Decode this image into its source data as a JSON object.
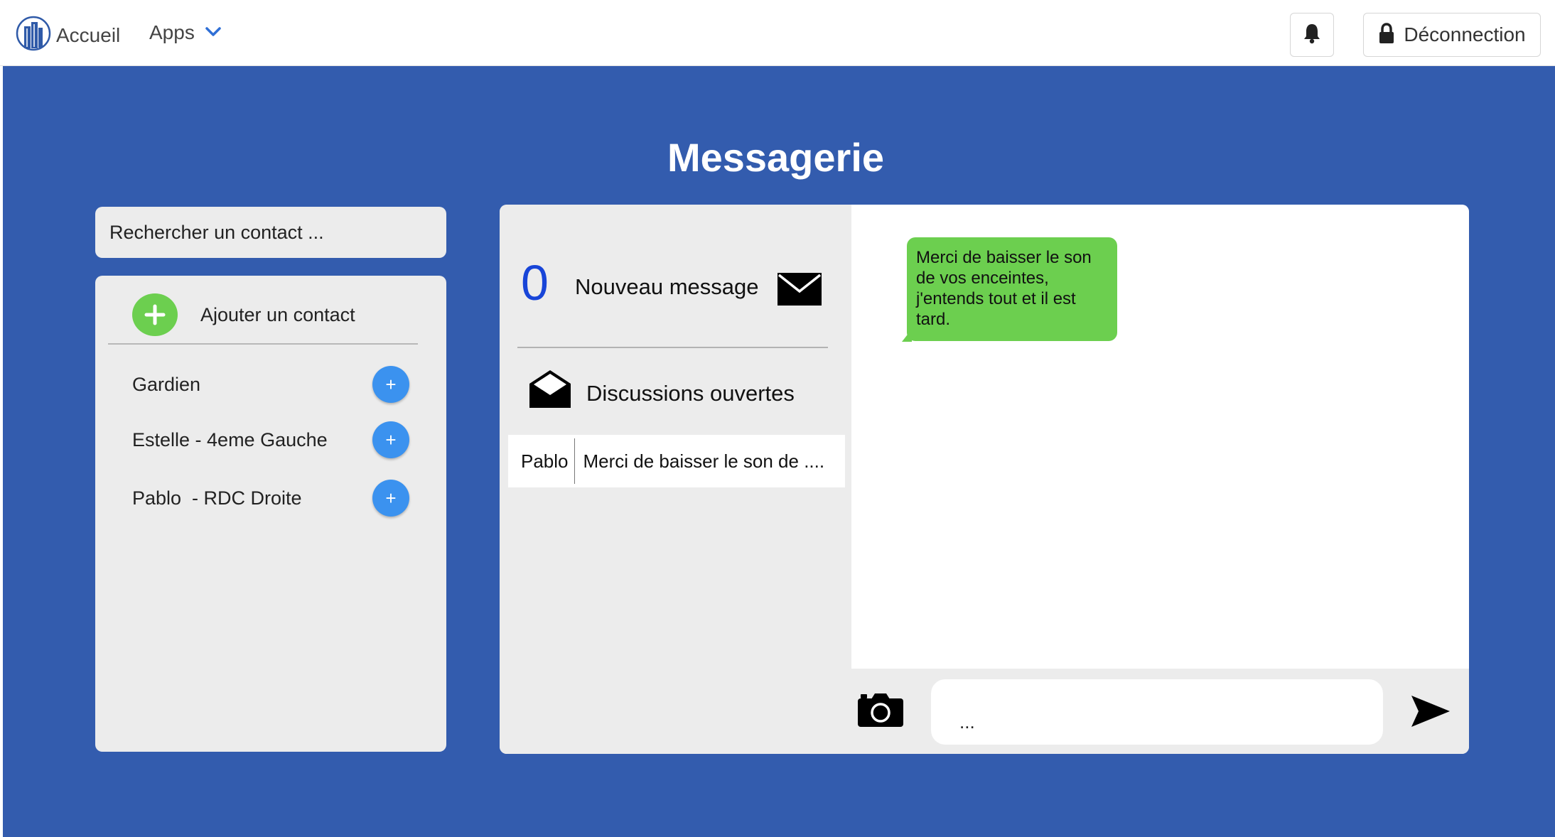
{
  "navbar": {
    "home_label": "Accueil",
    "apps_label": "Apps",
    "logout_label": "Déconnection"
  },
  "page": {
    "title": "Messagerie"
  },
  "contacts": {
    "search_placeholder": "Rechercher un contact ...",
    "add_contact_label": "Ajouter un contact",
    "items": [
      {
        "name": "Gardien",
        "add_symbol": "+"
      },
      {
        "name": "Estelle - 4eme Gauche",
        "add_symbol": "+"
      },
      {
        "name": "Pablo  - RDC Droite",
        "add_symbol": "+"
      }
    ]
  },
  "messenger": {
    "new_count": "0",
    "new_label": "Nouveau message",
    "open_label": "Discussions ouvertes",
    "threads": [
      {
        "name": "Pablo",
        "preview": "Merci de baisser le son de ...."
      }
    ],
    "messages": [
      {
        "text": "Merci de baisser le son de vos enceintes, j'entends tout et il est tard.",
        "color": "#6ccf4f"
      }
    ],
    "composer_placeholder": "..."
  },
  "colors": {
    "background_blue": "#335cae",
    "panel_grey": "#ececec",
    "add_green": "#6ccf4f",
    "contact_add_blue": "#3b92ef",
    "count_blue": "#1845d8"
  },
  "icons": {
    "brand": "building-logo-icon",
    "apps": "chevron-down-icon",
    "notifications": "bell-icon",
    "logout": "lock-icon",
    "add_contact": "plus-icon",
    "new_message": "envelope-icon",
    "open_discussions": "open-envelope-icon",
    "attach": "camera-icon",
    "send": "send-icon"
  }
}
